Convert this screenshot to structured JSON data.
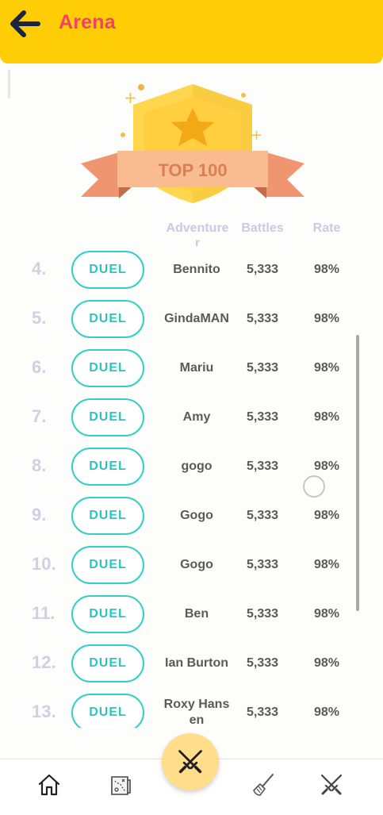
{
  "header": {
    "title": "Arena",
    "back_icon": "arrow-left-icon"
  },
  "trophy": {
    "label": "TOP 100"
  },
  "columns": {
    "adventurer": "Adventure r",
    "battles": "Battles",
    "rate": "Rate"
  },
  "rows": [
    {
      "rank": "4.",
      "action": "DUEL",
      "name": "Bennito",
      "battles": "5,333",
      "rate": "98%"
    },
    {
      "rank": "5.",
      "action": "DUEL",
      "name": "GindaMAN",
      "battles": "5,333",
      "rate": "98%"
    },
    {
      "rank": "6.",
      "action": "DUEL",
      "name": "Mariu",
      "battles": "5,333",
      "rate": "98%"
    },
    {
      "rank": "7.",
      "action": "DUEL",
      "name": "Amy",
      "battles": "5,333",
      "rate": "98%"
    },
    {
      "rank": "8.",
      "action": "DUEL",
      "name": "gogo",
      "battles": "5,333",
      "rate": "98%"
    },
    {
      "rank": "9.",
      "action": "DUEL",
      "name": "Gogo",
      "battles": "5,333",
      "rate": "98%"
    },
    {
      "rank": "10.",
      "action": "DUEL",
      "name": "Gogo",
      "battles": "5,333",
      "rate": "98%"
    },
    {
      "rank": "11.",
      "action": "DUEL",
      "name": "Ben",
      "battles": "5,333",
      "rate": "98%"
    },
    {
      "rank": "12.",
      "action": "DUEL",
      "name": "Ian Burton",
      "battles": "5,333",
      "rate": "98%"
    },
    {
      "rank": "13.",
      "action": "DUEL",
      "name": "Roxy Hansen",
      "battles": "5,333",
      "rate": "98%"
    }
  ],
  "bottom_nav": {
    "items": [
      "home-icon",
      "map-icon",
      "arena-swords-icon",
      "broom-icon",
      "crossed-swords-icon"
    ],
    "active": "arena-swords-icon"
  },
  "colors": {
    "header": "#ffcd05",
    "title": "#f0436a",
    "duel": "#35cec7",
    "rank": "#ced1e3",
    "ribbon": "#f4a87c",
    "badge": "#ffd64d"
  }
}
